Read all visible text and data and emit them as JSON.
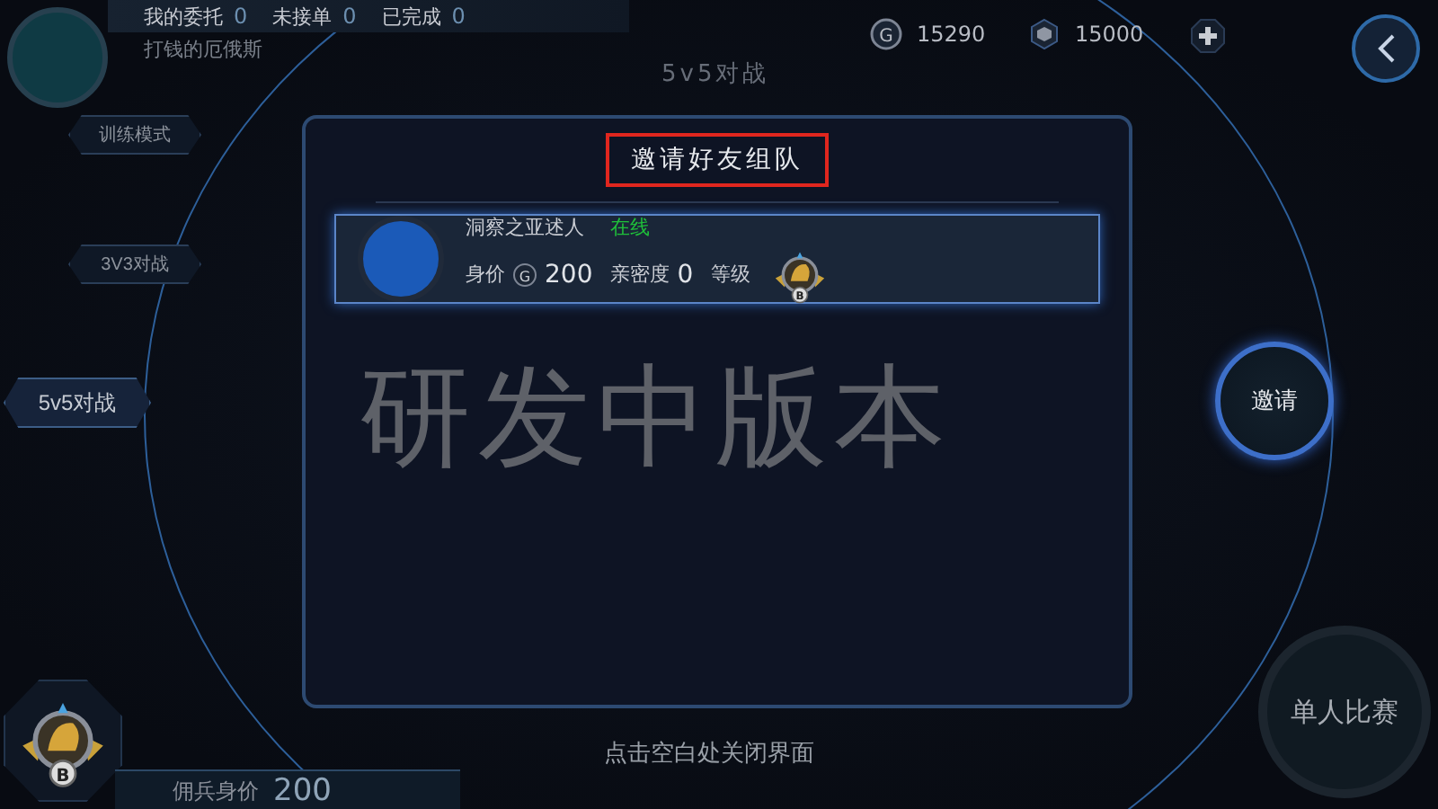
{
  "header": {
    "stats": [
      {
        "label": "我的委托",
        "value": "0"
      },
      {
        "label": "未接单",
        "value": "0"
      },
      {
        "label": "已完成",
        "value": "0"
      }
    ],
    "player_name": "打钱的厄俄斯"
  },
  "currencies": [
    {
      "kind": "gold",
      "symbol": "G",
      "value": "15290"
    },
    {
      "kind": "gem",
      "value": "15000"
    }
  ],
  "modes": [
    {
      "label": "训练模式",
      "selected": false
    },
    {
      "label": "3V3对战",
      "selected": false
    },
    {
      "label": "5v5对战",
      "selected": true
    }
  ],
  "mode_title": "5v5对战",
  "dialog": {
    "title": "邀请好友组队",
    "friends": [
      {
        "name": "洞察之亚述人",
        "online": true,
        "status": "在线",
        "price_label": "身价",
        "price_symbol": "G",
        "price": "200",
        "intimacy_label": "亲密度",
        "intimacy": "0",
        "rank_label": "等级",
        "rank_letter": "B"
      }
    ],
    "footer": "点击空白处关闭界面"
  },
  "overlay_text": "研发中版本",
  "invite_button": "邀请",
  "solo_button": "单人比赛",
  "rank_badge": {
    "letter": "B"
  },
  "mercenary": {
    "label": "佣兵身价",
    "value": "200"
  }
}
